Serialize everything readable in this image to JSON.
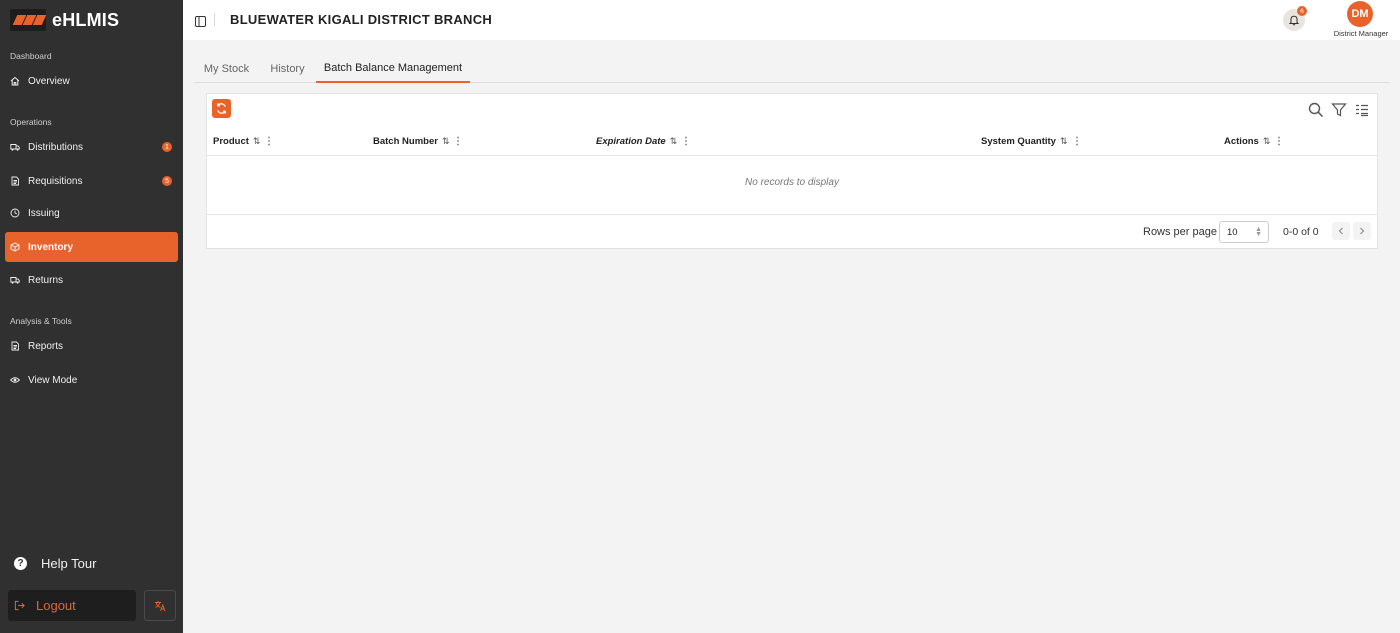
{
  "brand": {
    "name": "eHLMIS"
  },
  "sidebar": {
    "sections": [
      {
        "label": "Dashboard"
      },
      {
        "label": "Operations"
      },
      {
        "label": "Analysis & Tools"
      }
    ],
    "items": [
      {
        "label": "Overview",
        "icon": "home-icon"
      },
      {
        "label": "Distributions",
        "icon": "truck-icon",
        "badge": "1"
      },
      {
        "label": "Requisitions",
        "icon": "document-icon",
        "badge": "5"
      },
      {
        "label": "Issuing",
        "icon": "issuing-icon"
      },
      {
        "label": "Inventory",
        "icon": "box-icon",
        "active": true
      },
      {
        "label": "Returns",
        "icon": "truck-icon"
      },
      {
        "label": "Reports",
        "icon": "document-icon"
      },
      {
        "label": "View Mode",
        "icon": "eye-icon"
      }
    ],
    "help_tour": "Help Tour",
    "logout": "Logout"
  },
  "header": {
    "branch": "BLUEWATER KIGALI DISTRICT BRANCH",
    "notification_count": "6",
    "avatar_initials": "DM",
    "role": "District Manager"
  },
  "tabs": [
    {
      "label": "My Stock"
    },
    {
      "label": "History"
    },
    {
      "label": "Batch Balance Management",
      "active": true
    }
  ],
  "table": {
    "columns": [
      {
        "label": "Product"
      },
      {
        "label": "Batch Number"
      },
      {
        "label": "Expiration Date"
      },
      {
        "label": "System Quantity"
      },
      {
        "label": "Actions"
      }
    ],
    "empty_message": "No records to display"
  },
  "pagination": {
    "rows_per_page_label": "Rows per page",
    "rows_per_page_value": "10",
    "range": "0-0 of 0"
  },
  "colors": {
    "accent": "#e8632b",
    "sidebar_bg": "#303030"
  }
}
